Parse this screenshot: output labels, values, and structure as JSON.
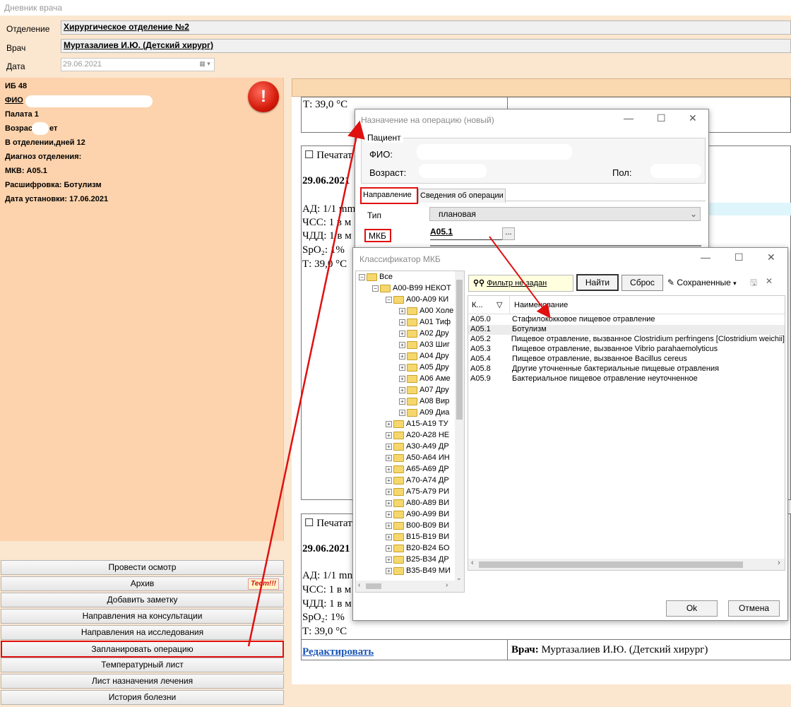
{
  "window": {
    "title": "Дневник врача"
  },
  "header": {
    "department_label": "Отделение",
    "department_value": "Хирургическое отделение №2",
    "doctor_label": "Врач",
    "doctor_value": "Муртазалиев И.Ю. (Детский хирург)",
    "date_label": "Дата",
    "date_value": "29.06.2021"
  },
  "patient_panel": {
    "ib": "ИБ 48",
    "fio_label": "ФИО",
    "ward": "Палата 1",
    "age_prefix": "Возрас",
    "age_suffix": "ет",
    "days": "В отделении,дней 12",
    "diag_label": "Диагноз отделения:",
    "mkb": "МКВ: A05.1",
    "decode": "Расшифровка: Ботулизм",
    "set_date": "Дата установки: 17.06.2021",
    "alert_icon": "!"
  },
  "actions": [
    {
      "label": "Провести осмотр"
    },
    {
      "label": "Архив",
      "badge": "Тест!!!"
    },
    {
      "label": "Добавить заметку"
    },
    {
      "label": "Направления на консультации"
    },
    {
      "label": "Направления на исследования"
    },
    {
      "label": "Запланировать операцию"
    },
    {
      "label": "Температурный лист"
    },
    {
      "label": "Лист назначения лечения"
    },
    {
      "label": "История болезни"
    }
  ],
  "records": {
    "temp_top": "Т: 39,0 °C",
    "print_label": "Печатат",
    "date": "29.06.2021",
    "ad": "АД: 1/1 mm",
    "ad2": "АД: 1/1 mn",
    "chss": "ЧСС: 1 в м",
    "chdd": "ЧДД: 1 в м",
    "spo2": "SpO₂: 1%",
    "temp": "Т: 39,0 °C",
    "edit_link": "Редактировать",
    "doctor_line_label": "Врач:",
    "doctor_line_value": "Муртазалиев И.Ю. (Детский хирург)"
  },
  "op_dialog": {
    "title": "Назначение на операцию (новый)",
    "group_label": "Пациент",
    "fio_label": "ФИО:",
    "age_label": "Возраст:",
    "sex_label": "Пол:",
    "tab1": "Направление",
    "tab2": "Сведения об операции",
    "type_label": "Тип",
    "type_value": "плановая",
    "mkb_label": "МКБ",
    "mkb_value": "A05.1",
    "mkb_btn": "..."
  },
  "mkb_dialog": {
    "title": "Классификатор МКБ",
    "filter_label": "Фильтр не задан",
    "find_btn": "Найти",
    "reset_btn": "Сброс",
    "saved_label": "Сохраненные",
    "col_code": "К...",
    "col_name": "Наименование",
    "ok_btn": "Ok",
    "cancel_btn": "Отмена",
    "tree": [
      {
        "label": "Все",
        "level": 0,
        "sign": "−"
      },
      {
        "label": "A00-B99 НЕКОТ",
        "level": 1,
        "sign": "−"
      },
      {
        "label": "A00-A09 КИ",
        "level": 2,
        "sign": "−"
      },
      {
        "label": "A00 Холе",
        "level": 3,
        "sign": "+"
      },
      {
        "label": "A01 Тиф",
        "level": 3,
        "sign": "+"
      },
      {
        "label": "A02 Дру",
        "level": 3,
        "sign": "+"
      },
      {
        "label": "A03 Шиг",
        "level": 3,
        "sign": "+"
      },
      {
        "label": "A04 Дру",
        "level": 3,
        "sign": "+"
      },
      {
        "label": "A05 Дру",
        "level": 3,
        "sign": "+"
      },
      {
        "label": "A06 Аме",
        "level": 3,
        "sign": "+"
      },
      {
        "label": "A07 Дру",
        "level": 3,
        "sign": "+"
      },
      {
        "label": "A08 Вир",
        "level": 3,
        "sign": "+"
      },
      {
        "label": "A09 Диа",
        "level": 3,
        "sign": "+"
      },
      {
        "label": "A15-A19 ТУ",
        "level": 2,
        "sign": "+"
      },
      {
        "label": "A20-A28 НЕ",
        "level": 2,
        "sign": "+"
      },
      {
        "label": "A30-A49 ДР",
        "level": 2,
        "sign": "+"
      },
      {
        "label": "A50-A64 ИН",
        "level": 2,
        "sign": "+"
      },
      {
        "label": "A65-A69 ДР",
        "level": 2,
        "sign": "+"
      },
      {
        "label": "A70-A74 ДР",
        "level": 2,
        "sign": "+"
      },
      {
        "label": "A75-A79 РИ",
        "level": 2,
        "sign": "+"
      },
      {
        "label": "A80-A89 ВИ",
        "level": 2,
        "sign": "+"
      },
      {
        "label": "A90-A99 ВИ",
        "level": 2,
        "sign": "+"
      },
      {
        "label": "B00-B09 ВИ",
        "level": 2,
        "sign": "+"
      },
      {
        "label": "B15-B19 ВИ",
        "level": 2,
        "sign": "+"
      },
      {
        "label": "B20-B24 БО",
        "level": 2,
        "sign": "+"
      },
      {
        "label": "B25-B34 ДР",
        "level": 2,
        "sign": "+"
      },
      {
        "label": "B35-B49 МИ",
        "level": 2,
        "sign": "+"
      }
    ],
    "rows": [
      {
        "code": "A05.0",
        "name": "Стафилококковое пищевое отравление"
      },
      {
        "code": "A05.1",
        "name": "Ботулизм"
      },
      {
        "code": "A05.2",
        "name": "Пищевое отравление, вызванное Clostridium perfringens [Clostridium weichii]"
      },
      {
        "code": "A05.3",
        "name": "Пищевое отравление, вызванное Vibrio parahaemolyticus"
      },
      {
        "code": "A05.4",
        "name": "Пищевое отравление, вызванное Bacillus cereus"
      },
      {
        "code": "A05.8",
        "name": "Другие уточненные бактериальные пищевые отравления"
      },
      {
        "code": "A05.9",
        "name": "Бактериальное пищевое отравление неуточненное"
      }
    ]
  },
  "colors": {
    "highlight": "#e01010",
    "panel": "#fcd3ad",
    "background": "#fbe6cf"
  }
}
